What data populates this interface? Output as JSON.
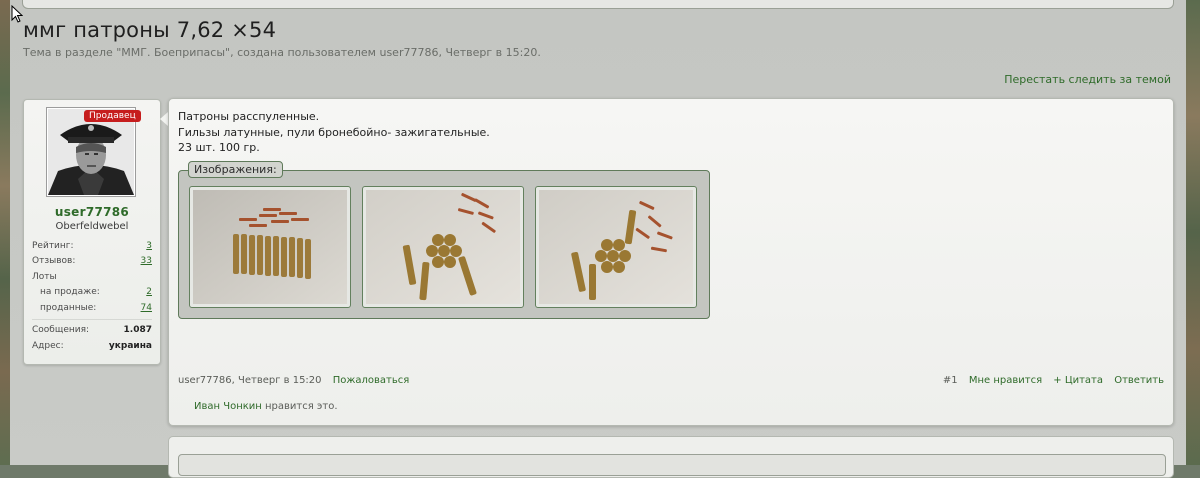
{
  "thread": {
    "title": "ммг патроны 7,62 ×54",
    "subtitle": "Тема в разделе \"ММГ. Боеприпасы\", создана пользователем user77786, Четверг в 15:20.",
    "follow_link": "Перестать следить за темой"
  },
  "user": {
    "badge": "Продавец",
    "name": "user77786",
    "rank": "Oberfeldwebel",
    "stats": {
      "rating_label": "Рейтинг:",
      "rating_value": "3",
      "reviews_label": "Отзывов:",
      "reviews_value": "33",
      "lots_label": "Лоты",
      "on_sale_label": "на продаже:",
      "on_sale_value": "2",
      "sold_label": "проданные:",
      "sold_value": "74",
      "messages_label": "Сообщения:",
      "messages_value": "1.087",
      "address_label": "Адрес:",
      "address_value": "украина"
    }
  },
  "post": {
    "lines": [
      "Патроны расспуленные.",
      "Гильзы латунные, пули бронебойно- зажигательные.",
      "23 шт. 100 гр."
    ],
    "gallery_label": "Изображения:",
    "meta_author_time": "user77786, Четверг в 15:20",
    "report": "Пожаловаться",
    "post_number": "#1",
    "like": "Мне нравится",
    "quote": "+ Цитата",
    "reply": "Ответить",
    "liked_by": "Иван Чонкин",
    "liked_suffix": "нравится это."
  },
  "colors": {
    "accent_green": "#2f6b2a",
    "badge_red": "#c61d1d"
  }
}
